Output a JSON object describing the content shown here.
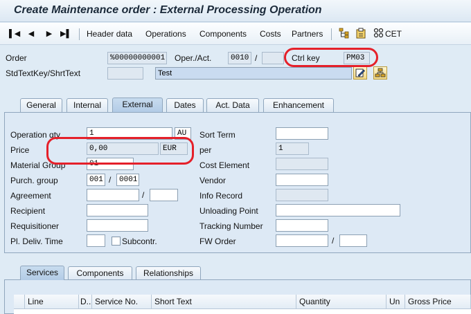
{
  "window": {
    "title": "Create Maintenance order : External Processing Operation"
  },
  "toolbar": {
    "items": [
      "Header data",
      "Operations",
      "Components",
      "Costs",
      "Partners"
    ],
    "cet_label": "CET"
  },
  "header": {
    "order_label": "Order",
    "order_value": "%00000000001",
    "operact_label": "Oper./Act.",
    "operact_value": "0010",
    "operact_sep": "/",
    "operact_sub": "",
    "ctrlkey_label": "Ctrl key",
    "ctrlkey_value": "PM03",
    "stdtext_label": "StdTextKey/ShrtText",
    "stdtext_value": "",
    "shorttext_value": "Test"
  },
  "tabs": [
    {
      "label": "General",
      "active": false
    },
    {
      "label": "Internal",
      "active": false
    },
    {
      "label": "External",
      "active": true
    },
    {
      "label": "Dates",
      "active": false
    },
    {
      "label": "Act. Data",
      "active": false
    },
    {
      "label": "Enhancement",
      "active": false
    }
  ],
  "external": {
    "operation_qty_label": "Operation qty",
    "operation_qty_value": "1",
    "operation_qty_unit": "AU",
    "price_label": "Price",
    "price_value": "0,00",
    "price_currency": "EUR",
    "material_group_label": "Material Group",
    "material_group_value": "01",
    "purch_group_label": "Purch. group",
    "purch_group_value": "001",
    "purch_org_value": "0001",
    "slash": "/",
    "agreement_label": "Agreement",
    "agreement_value": "",
    "agreement_item": "",
    "recipient_label": "Recipient",
    "recipient_value": "",
    "requisitioner_label": "Requisitioner",
    "requisitioner_value": "",
    "pl_deliv_label": "Pl. Deliv. Time",
    "pl_deliv_value": "",
    "subcontr_label": "Subcontr.",
    "sort_term_label": "Sort Term",
    "sort_term_value": "",
    "per_label": "per",
    "per_value": "1",
    "cost_element_label": "Cost Element",
    "cost_element_value": "",
    "vendor_label": "Vendor",
    "vendor_value": "",
    "info_record_label": "Info Record",
    "info_record_value": "",
    "unloading_point_label": "Unloading Point",
    "unloading_point_value": "",
    "tracking_number_label": "Tracking Number",
    "tracking_number_value": "",
    "fw_order_label": "FW Order",
    "fw_order_value": "",
    "fw_order_item": ""
  },
  "lower_tabs": [
    {
      "label": "Services",
      "active": true
    },
    {
      "label": "Components",
      "active": false
    },
    {
      "label": "Relationships",
      "active": false
    }
  ],
  "services_table": {
    "columns": [
      "Line",
      "D..",
      "Service No.",
      "Short Text",
      "Quantity",
      "Un",
      "Gross Price"
    ]
  },
  "colors": {
    "annotation": "#e5202a",
    "background": "#dfebf5"
  },
  "icons": [
    "first-page-icon",
    "previous-page-icon",
    "next-page-icon",
    "last-page-icon",
    "hierarchy-icon",
    "clipboard-icon",
    "cet-icon",
    "edit-icon",
    "structure-icon"
  ]
}
